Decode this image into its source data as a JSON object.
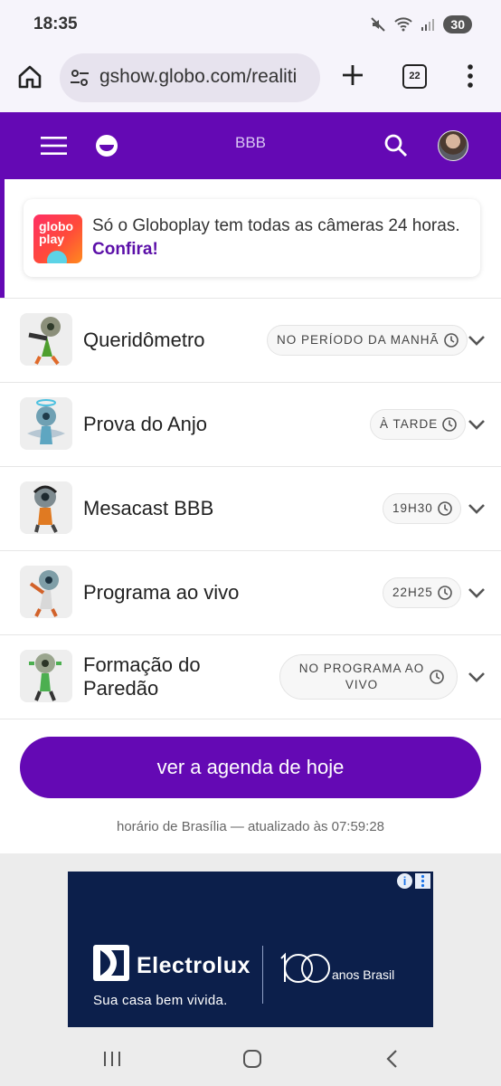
{
  "status_bar": {
    "time": "18:35",
    "battery": "30"
  },
  "browser": {
    "url": "gshow.globo.com/realiti",
    "tab_count": "22"
  },
  "site_header": {
    "title": "BBB"
  },
  "promo": {
    "logo_text_line1": "globo",
    "logo_text_line2": "play",
    "text": "Só o Globoplay tem todas as câmeras 24 horas.",
    "link": "Confira!"
  },
  "schedule": [
    {
      "name": "Queridômetro",
      "time": "NO PERÍODO DA MANHÃ"
    },
    {
      "name": "Prova do Anjo",
      "time": "À TARDE"
    },
    {
      "name": "Mesacast BBB",
      "time": "19H30"
    },
    {
      "name": "Programa ao vivo",
      "time": "22H25"
    },
    {
      "name": "Formação do Paredão",
      "time": "NO PROGRAMA AO VIVO"
    }
  ],
  "agenda_button": "ver a agenda de hoje",
  "updated_note": "horário de Brasília — atualizado às 07:59:28",
  "ad": {
    "brand": "Electrolux",
    "slogan": "Sua casa bem vivida.",
    "anniversary_text": "anos Brasil"
  },
  "colors": {
    "brand_purple": "#6409b4",
    "ad_navy": "#0c1f4b"
  }
}
